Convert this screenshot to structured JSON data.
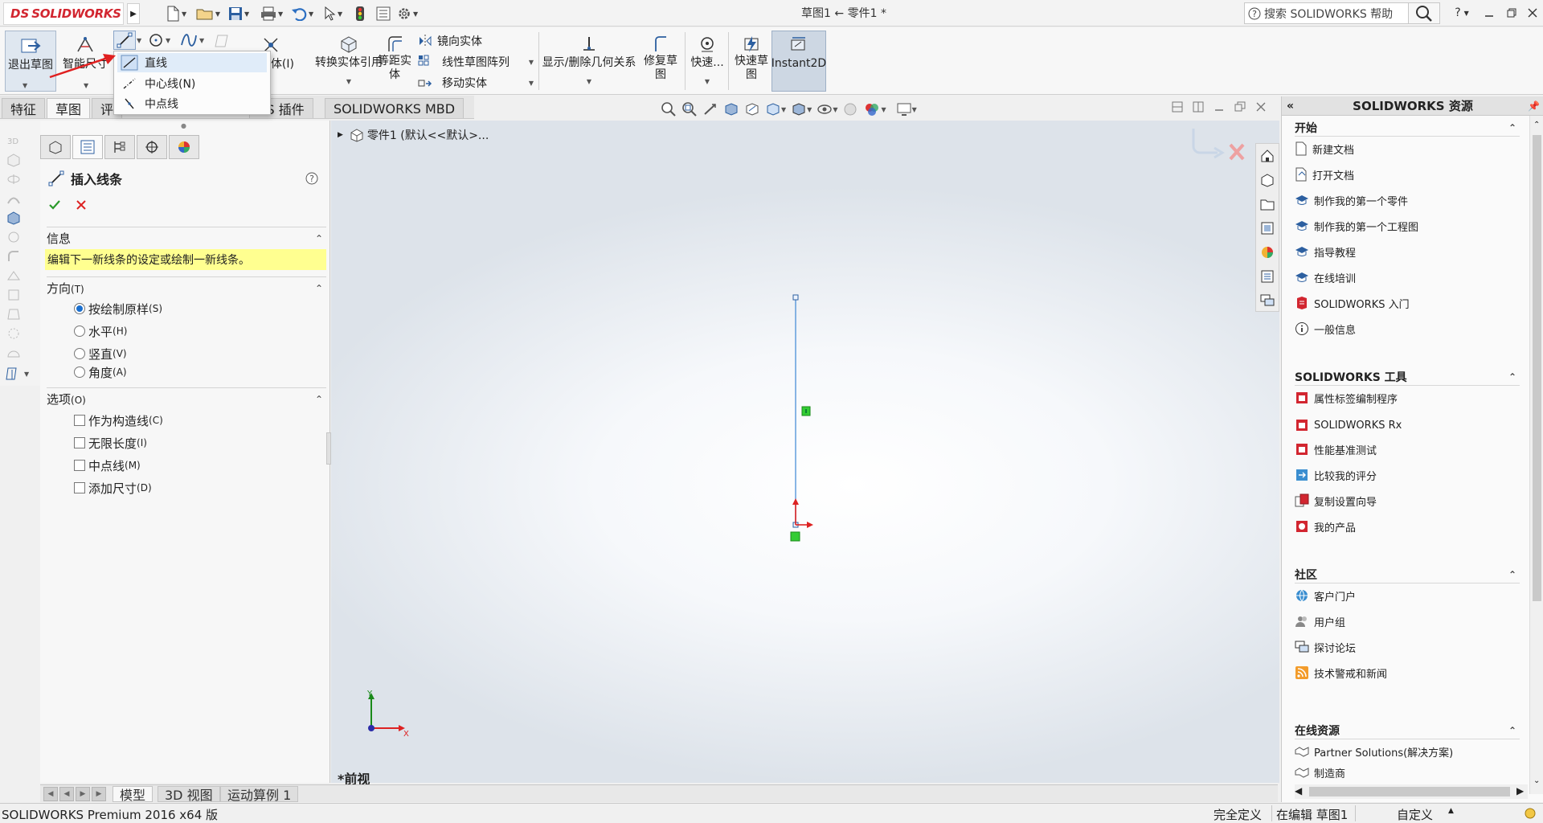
{
  "app": {
    "logo_ds": "DS",
    "logo_name": "SOLIDWORKS",
    "doc_title": "草图1 ← 零件1 *",
    "help_search_placeholder": "搜索 SOLIDWORKS 帮助",
    "help_label": "?"
  },
  "commands": {
    "exit_sketch": "退出草图",
    "smart_dimension": "智能尺寸",
    "entities_partial": "体(I)",
    "convert_entities": "转换实体引用",
    "offset_entities": "等距实\n体",
    "mirror_entities": "镜向实体",
    "linear_pattern": "线性草图阵列",
    "move_entities": "移动实体",
    "display_delete_relations": "显示/删除几何关系",
    "repair_sketch": "修复草\n图",
    "quick_snaps": "快速...",
    "rapid_sketch": "快速草\n图",
    "instant2d": "Instant2D"
  },
  "line_menu": {
    "items": [
      "直线",
      "中心线(N)",
      "中点线"
    ]
  },
  "tabs": {
    "items": [
      "特征",
      "草图",
      "评",
      "KS 插件",
      "SOLIDWORKS MBD"
    ]
  },
  "property_manager": {
    "title": "插入线条",
    "help": "?",
    "info_header": "信息",
    "info_text": "编辑下一新线条的设定或绘制一新线条。",
    "orientation_header": "方向",
    "orientation_sc": "(T)",
    "orientation_options": [
      {
        "label": "按绘制原样",
        "sc": "(S)",
        "checked": true
      },
      {
        "label": "水平",
        "sc": "(H)",
        "checked": false
      },
      {
        "label": "竖直",
        "sc": "(V)",
        "checked": false
      },
      {
        "label": "角度",
        "sc": "(A)",
        "checked": false
      }
    ],
    "options_header": "选项",
    "options_sc": "(O)",
    "options": [
      {
        "label": "作为构造线",
        "sc": "(C)"
      },
      {
        "label": "无限长度",
        "sc": "(I)"
      },
      {
        "label": "中点线",
        "sc": "(M)"
      },
      {
        "label": "添加尺寸",
        "sc": "(D)"
      }
    ]
  },
  "graphics": {
    "tree_root": "零件1  (默认<<默认>...",
    "view_name": "*前视",
    "axis_x": "X",
    "axis_y": "Y"
  },
  "bottom_tabs": {
    "items": [
      "模型",
      "3D 视图",
      "运动算例 1"
    ]
  },
  "status": {
    "product": "SOLIDWORKS Premium 2016 x64 版",
    "defined": "完全定义",
    "editing": "在编辑 草图1",
    "custom": "自定义"
  },
  "resources": {
    "title": "SOLIDWORKS 资源",
    "sections": [
      {
        "title": "开始",
        "items": [
          "新建文档",
          "打开文档",
          "制作我的第一个零件",
          "制作我的第一个工程图",
          "指导教程",
          "在线培训",
          "SOLIDWORKS 入门",
          "一般信息"
        ]
      },
      {
        "title": "SOLIDWORKS 工具",
        "items": [
          "属性标签编制程序",
          "SOLIDWORKS Rx",
          "性能基准测试",
          "比较我的评分",
          "复制设置向导",
          "我的产品"
        ]
      },
      {
        "title": "社区",
        "items": [
          "客户门户",
          "用户组",
          "探讨论坛",
          "技术警戒和新闻"
        ]
      },
      {
        "title": "在线资源",
        "items": [
          "Partner Solutions(解决方案)",
          "制造商"
        ]
      }
    ]
  },
  "colors": {
    "brand_red": "#d22630",
    "accent_blue": "#1a6fcf",
    "info_yellow": "#ffff90",
    "sketch_line": "#4a8fd8"
  }
}
